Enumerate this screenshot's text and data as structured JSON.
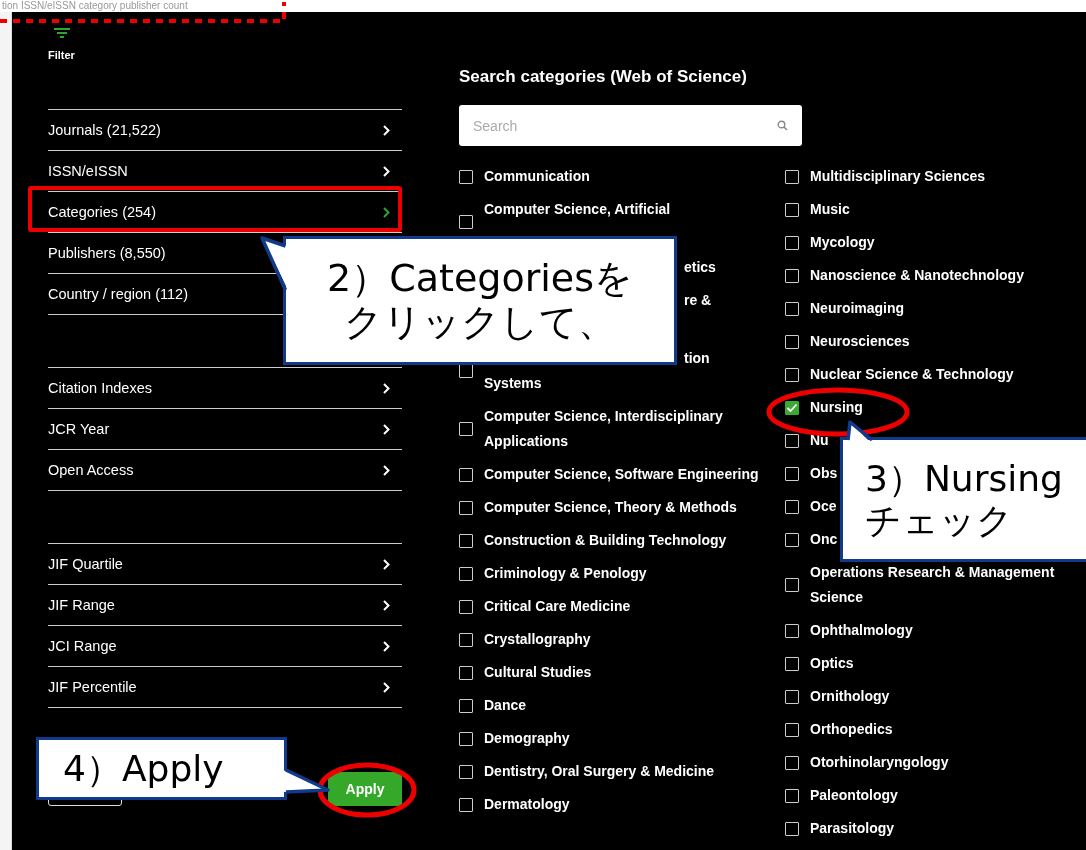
{
  "background_page": {
    "header_text": "tion ISSN/eISSN category publisher count"
  },
  "filter": {
    "label": "Filter"
  },
  "nav_groups": [
    {
      "items": [
        {
          "label": "Journals (21,522)",
          "selected": false
        },
        {
          "label": "ISSN/eISSN",
          "selected": false
        },
        {
          "label": "Categories (254)",
          "selected": true
        },
        {
          "label": "Publishers (8,550)"
        },
        {
          "label": "Country / region (112)"
        }
      ]
    },
    {
      "items": [
        {
          "label": "Citation Indexes",
          "selected": false
        },
        {
          "label": "JCR Year",
          "selected": false
        },
        {
          "label": "Open Access",
          "selected": false
        }
      ]
    },
    {
      "items": [
        {
          "label": "JIF Quartile",
          "selected": false
        },
        {
          "label": "JIF Range",
          "selected": false
        },
        {
          "label": "JCI Range",
          "selected": false
        },
        {
          "label": "JIF Percentile",
          "selected": false
        }
      ]
    }
  ],
  "apply_button": {
    "label": "Apply"
  },
  "categories": {
    "heading": "Search categories (Web of Science)",
    "search": {
      "placeholder": "Search"
    },
    "columns": [
      {
        "items": [
          {
            "kind": "item",
            "label": "Communication",
            "checked": false
          },
          {
            "kind": "item",
            "label": "Computer Science, Artificial",
            "checked": false,
            "second_line_hidden": true
          },
          {
            "kind": "covered",
            "tail": "etics"
          },
          {
            "kind": "covered",
            "tail": "re &",
            "second_line_hidden": true
          },
          {
            "kind": "covered",
            "tail": "tion",
            "second_line": "Systems",
            "checked": false
          },
          {
            "kind": "item",
            "label": "Computer Science, Interdisciplinary Applications",
            "checked": false
          },
          {
            "kind": "item",
            "label": "Computer Science, Software Engineering",
            "checked": false
          },
          {
            "kind": "item",
            "label": "Computer Science, Theory & Methods",
            "checked": false
          },
          {
            "kind": "item",
            "label": "Construction & Building Technology",
            "checked": false
          },
          {
            "kind": "item",
            "label": "Criminology & Penology",
            "checked": false
          },
          {
            "kind": "item",
            "label": "Critical Care Medicine",
            "checked": false
          },
          {
            "kind": "item",
            "label": "Crystallography",
            "checked": false
          },
          {
            "kind": "item",
            "label": "Cultural Studies",
            "checked": false
          },
          {
            "kind": "item",
            "label": "Dance",
            "checked": false
          },
          {
            "kind": "item",
            "label": "Demography",
            "checked": false
          },
          {
            "kind": "item",
            "label": "Dentistry, Oral Surgery & Medicine",
            "checked": false
          },
          {
            "kind": "item",
            "label": "Dermatology",
            "checked": false
          }
        ]
      },
      {
        "items": [
          {
            "kind": "item",
            "label": "Multidisciplinary Sciences",
            "checked": false
          },
          {
            "kind": "item",
            "label": "Music",
            "checked": false
          },
          {
            "kind": "item",
            "label": "Mycology",
            "checked": false
          },
          {
            "kind": "item",
            "label": "Nanoscience & Nanotechnology",
            "checked": false
          },
          {
            "kind": "item",
            "label": "Neuroimaging",
            "checked": false
          },
          {
            "kind": "item",
            "label": "Neurosciences",
            "checked": false
          },
          {
            "kind": "item",
            "label": "Nuclear Science & Technology",
            "checked": false
          },
          {
            "kind": "item",
            "label": "Nursing",
            "checked": true
          },
          {
            "kind": "item",
            "label": "Nu",
            "checked": false
          },
          {
            "kind": "item",
            "label": "Obs",
            "checked": false
          },
          {
            "kind": "item",
            "label": "Oce",
            "checked": false
          },
          {
            "kind": "item",
            "label": "Onc",
            "checked": false
          },
          {
            "kind": "item",
            "label": "Operations Research & Management Science",
            "checked": false
          },
          {
            "kind": "item",
            "label": "Ophthalmology",
            "checked": false
          },
          {
            "kind": "item",
            "label": "Optics",
            "checked": false
          },
          {
            "kind": "item",
            "label": "Ornithology",
            "checked": false
          },
          {
            "kind": "item",
            "label": "Orthopedics",
            "checked": false
          },
          {
            "kind": "item",
            "label": "Otorhinolaryngology",
            "checked": false
          },
          {
            "kind": "item",
            "label": "Paleontology",
            "checked": false
          },
          {
            "kind": "item",
            "label": "Parasitology",
            "checked": false
          }
        ]
      }
    ]
  },
  "callouts": [
    {
      "kind": "categories",
      "lines": [
        "2）Categoriesを",
        "クリックして、"
      ]
    },
    {
      "kind": "nursing",
      "lines": [
        "3）Nursing",
        "チェック"
      ]
    },
    {
      "kind": "apply",
      "lines": [
        "4）Apply"
      ]
    }
  ]
}
